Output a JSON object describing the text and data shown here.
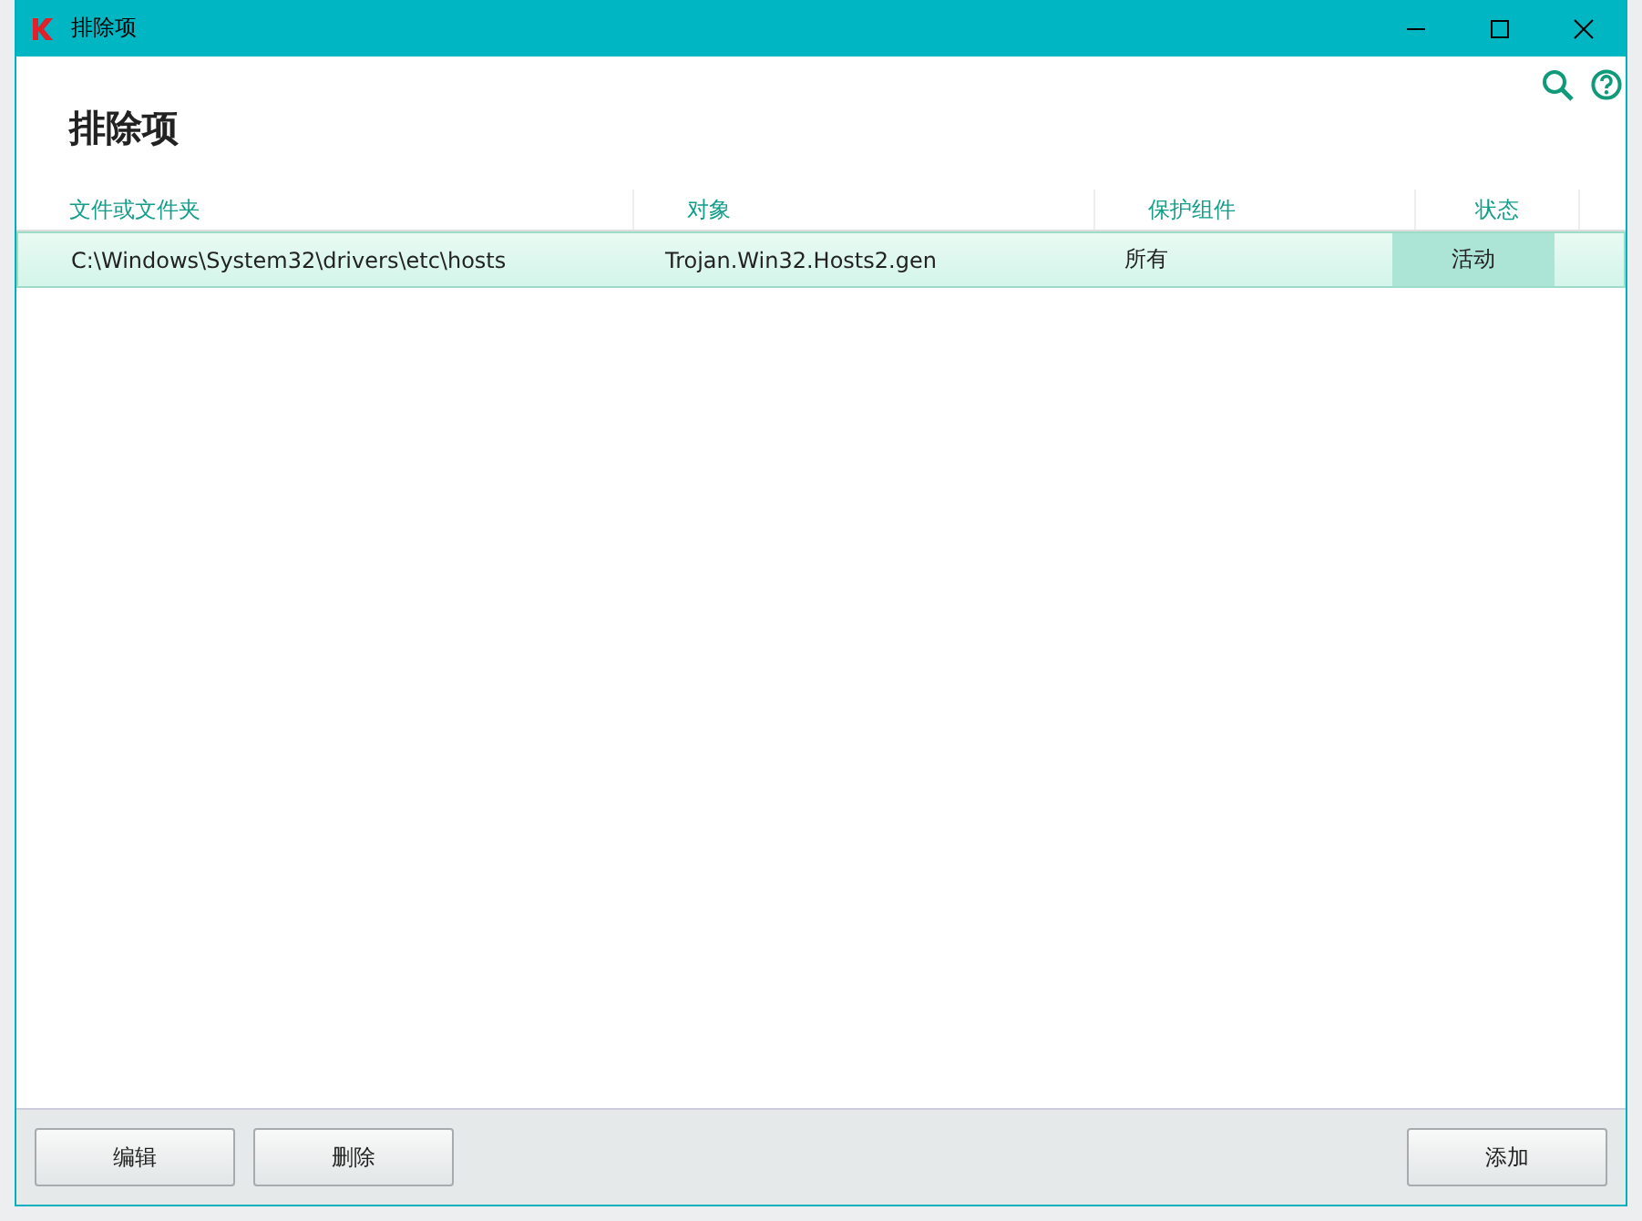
{
  "window": {
    "title": "排除项"
  },
  "heading": "排除项",
  "table": {
    "columns": [
      "文件或文件夹",
      "对象",
      "保护组件",
      "状态"
    ],
    "rows": [
      {
        "cells": [
          "C:\\Windows\\System32\\drivers\\etc\\hosts",
          "Trojan.Win32.Hosts2.gen",
          "所有",
          "活动"
        ],
        "selected": true
      }
    ]
  },
  "footer": {
    "left_buttons": [
      "编辑",
      "删除"
    ],
    "right_buttons": [
      "添加"
    ]
  }
}
